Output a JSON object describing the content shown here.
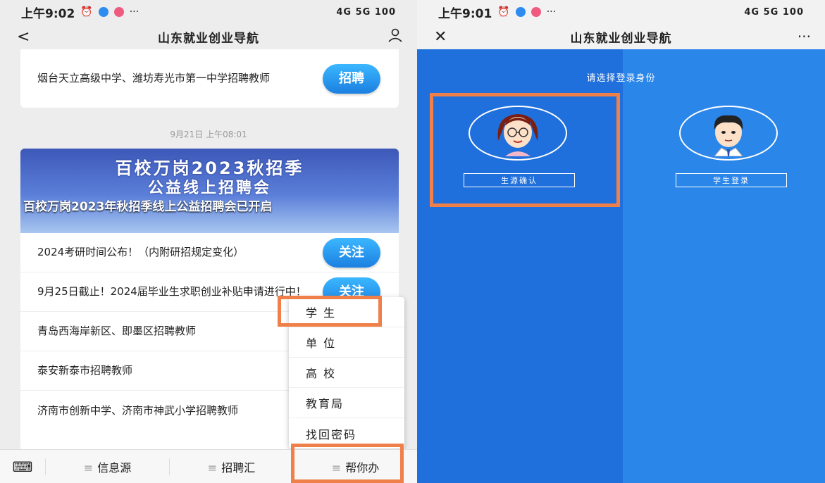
{
  "left": {
    "status": {
      "time": "上午9:02",
      "right": "4G 5G 100"
    },
    "title": "山东就业创业导航",
    "list1": [
      {
        "text": "烟台天立高级中学、潍坊寿光市第一中学招聘教师",
        "badge": "招聘"
      }
    ],
    "timestamp": "9月21日 上午08:01",
    "banner": {
      "line1": "百校万岗2023秋招季",
      "line2": "公益线上招聘会",
      "caption": "百校万岗2023年秋招季线上公益招聘会已开启"
    },
    "list2": [
      {
        "text": "2024考研时间公布！（内附研招规定变化）",
        "badge": "关注"
      },
      {
        "text": "9月25日截止！2024届毕业生求职创业补贴申请进行中！",
        "badge": "关注"
      },
      {
        "text": "青岛西海岸新区、即墨区招聘教师"
      },
      {
        "text": "泰安新泰市招聘教师"
      },
      {
        "text": "济南市创新中学、济南市神武小学招聘教师"
      }
    ],
    "popup": [
      "学 生",
      "单 位",
      "高 校",
      "教育局",
      "找回密码"
    ],
    "tabs": [
      "信息源",
      "招聘汇",
      "帮你办"
    ]
  },
  "right": {
    "status": {
      "time": "上午9:01",
      "right": "4G 5G 100"
    },
    "title": "山东就业创业导航",
    "prompt": "请选择登录身份",
    "btn_left": "生源确认",
    "btn_right": "学生登录"
  },
  "colors": {
    "accent_blue": "#1f6fdc",
    "highlight": "#f0804a"
  }
}
